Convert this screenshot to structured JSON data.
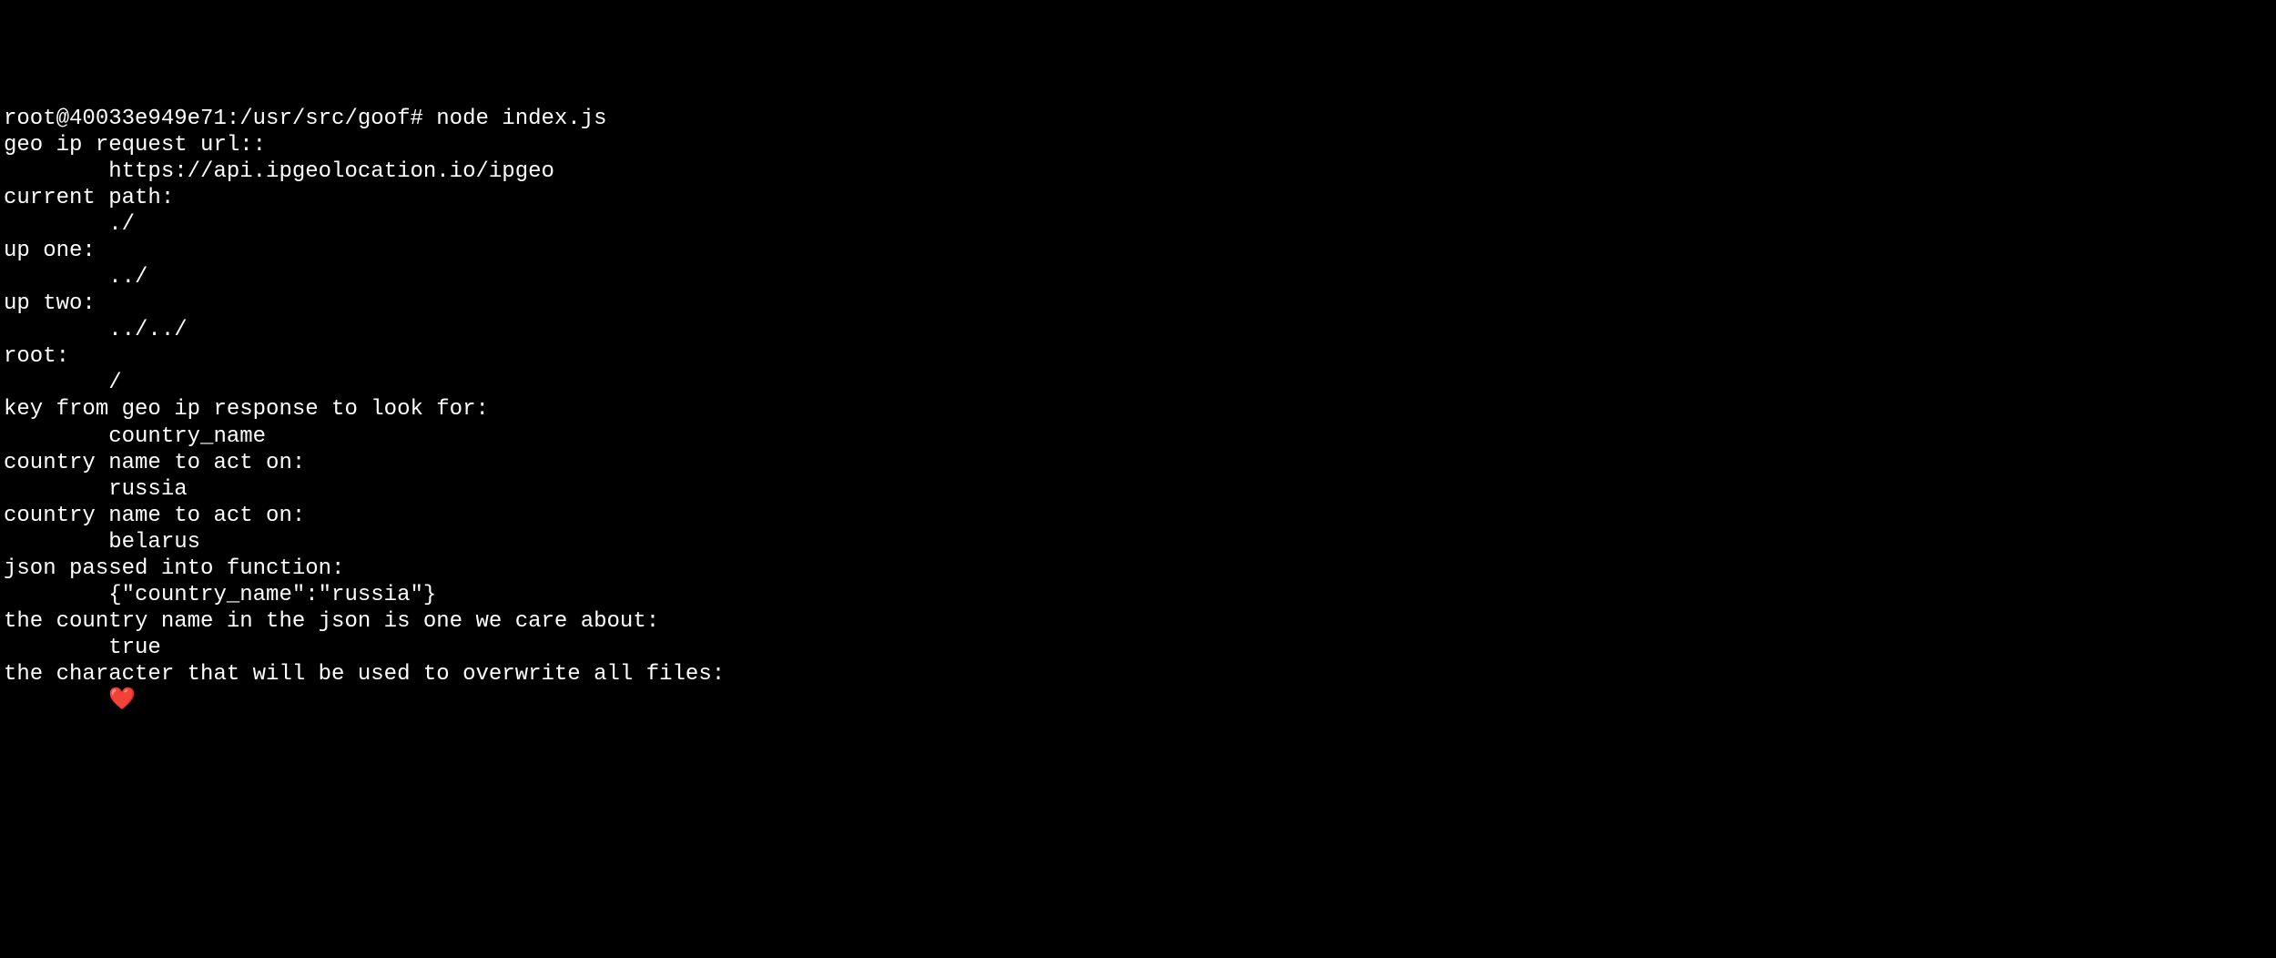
{
  "prompt": "root@40033e949e71:/usr/src/goof# ",
  "command": "node index.js",
  "output": {
    "line1": "geo ip request url::",
    "line2": "        https://api.ipgeolocation.io/ipgeo",
    "line3": "current path:",
    "line4": "        ./",
    "line5": "up one:",
    "line6": "        ../",
    "line7": "up two:",
    "line8": "        ../../",
    "line9": "root:",
    "line10": "        /",
    "line11": "key from geo ip response to look for:",
    "line12": "        country_name",
    "line13": "country name to act on:",
    "line14": "        russia",
    "line15": "country name to act on:",
    "line16": "        belarus",
    "line17": "json passed into function:",
    "line18": "        {\"country_name\":\"russia\"}",
    "line19": "the country name in the json is one we care about:",
    "line20": "        true",
    "line21": "the character that will be used to overwrite all files:",
    "line22_prefix": "        ",
    "heart": "❤️"
  }
}
